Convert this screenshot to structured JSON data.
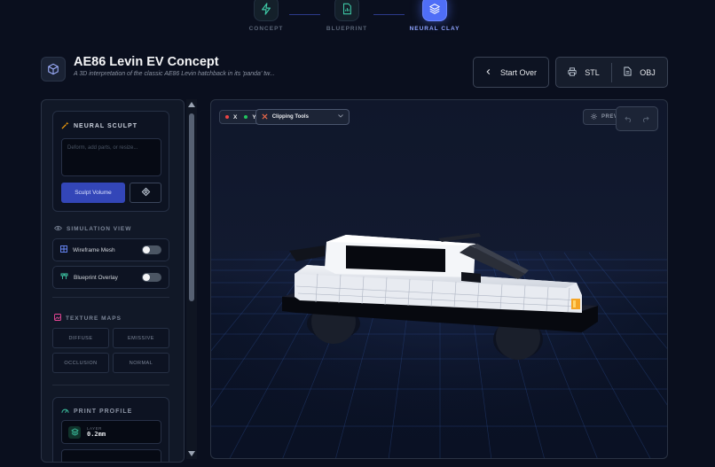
{
  "stepper": {
    "steps": [
      {
        "label": "CONCEPT",
        "icon": "bolt-icon",
        "state": "complete"
      },
      {
        "label": "BLUEPRINT",
        "icon": "file-chart-icon",
        "state": "complete"
      },
      {
        "label": "NEURAL CLAY",
        "icon": "layers-icon",
        "state": "active"
      }
    ]
  },
  "header": {
    "title": "AE86 Levin EV Concept",
    "subtitle": "A 3D interpretation of the classic AE86 Levin hatchback in its 'panda' tw...",
    "start_over_label": "Start Over",
    "export_stl_label": "STL",
    "export_obj_label": "OBJ"
  },
  "sidebar": {
    "neural_sculpt": {
      "heading": "NEURAL SCULPT",
      "placeholder": "Deform, add parts, or resize...",
      "sculpt_button_label": "Sculpt Volume"
    },
    "simulation_view": {
      "heading": "SIMULATION VIEW",
      "toggles": [
        {
          "label": "Wireframe Mesh",
          "on": false
        },
        {
          "label": "Blueprint Overlay",
          "on": false
        }
      ]
    },
    "texture_maps": {
      "heading": "TEXTURE MAPS",
      "buttons": [
        "DIFFUSE",
        "EMISSIVE",
        "OCCLUSION",
        "NORMAL"
      ]
    },
    "print_profile": {
      "heading": "PRINT PROFILE",
      "layer_key": "LAYER",
      "layer_value": "0.2mm"
    }
  },
  "viewport": {
    "axis_x": "X",
    "axis_y": "Y",
    "clipping_label": "Clipping Tools",
    "preview_label": "PREVI"
  },
  "colors": {
    "accent": "#4f6ef7",
    "background": "#0a0f1e",
    "axis_x": "#ef4444",
    "axis_y": "#22c55e"
  }
}
